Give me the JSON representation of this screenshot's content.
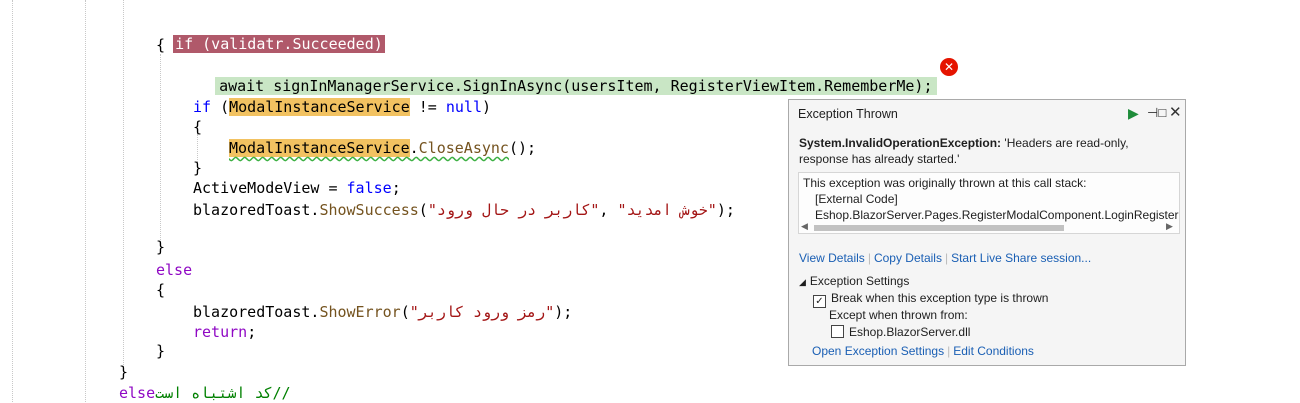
{
  "code": {
    "if_succeeded": "if (validatr.Succeeded)",
    "brace_open": "{",
    "brace_close": "}",
    "await_stmt": "await signInManagerService.SignInAsync(usersItem, RegisterViewItem.RememberMe);",
    "if_kw": "if",
    "modal_service": "ModalInstanceService",
    "not_equal": " != ",
    "null_kw": "null",
    "close_paren": ")",
    "open_paren": " (",
    "close_async": "CloseAsync",
    "call_end": "();",
    "dot": ".",
    "active_mode": "ActiveModeView = ",
    "false_kw": "false",
    "semicolon": ";",
    "toast_obj": "blazoredToast",
    "show_success": "ShowSuccess",
    "success_arg1": "\"کاربر در حال ورود\"",
    "success_arg2": "\"خوش امدید\"",
    "comma": ", ",
    "paren_open": "(",
    "paren_close_semi": ");",
    "else_kw": "else",
    "show_error": "ShowError",
    "error_arg": "\"رمز ورود کاربر\"",
    "return_kw": "return",
    "final_else": "else",
    "final_comment": "//کد اشتباه است"
  },
  "error_glyph": "✕",
  "popup": {
    "title": "Exception Thrown",
    "exception_type": "System.InvalidOperationException:",
    "exception_msg": " 'Headers are read-only, response has already started.'",
    "stack_header": "This exception was originally thrown at this call stack:",
    "stack_line1": "[External Code]",
    "stack_line2": "Eshop.BlazorServer.Pages.RegisterModalComponent.LoginRegisterUser",
    "link_view_details": "View Details",
    "link_copy_details": "Copy Details",
    "link_live_share": "Start Live Share session...",
    "settings_header": "Exception Settings",
    "break_when": "Break when this exception type is thrown",
    "except_when": "Except when thrown from:",
    "dll_name": "Eshop.BlazorServer.dll",
    "link_open_settings": "Open Exception Settings",
    "link_edit_conditions": "Edit Conditions",
    "play_glyph": "▶",
    "pin_glyph": "⊣□",
    "close_glyph": "✕",
    "expander_glyph": "◢",
    "check_glyph": "✓",
    "scroll_left": "◀",
    "scroll_right": "▶",
    "separator": "|"
  }
}
